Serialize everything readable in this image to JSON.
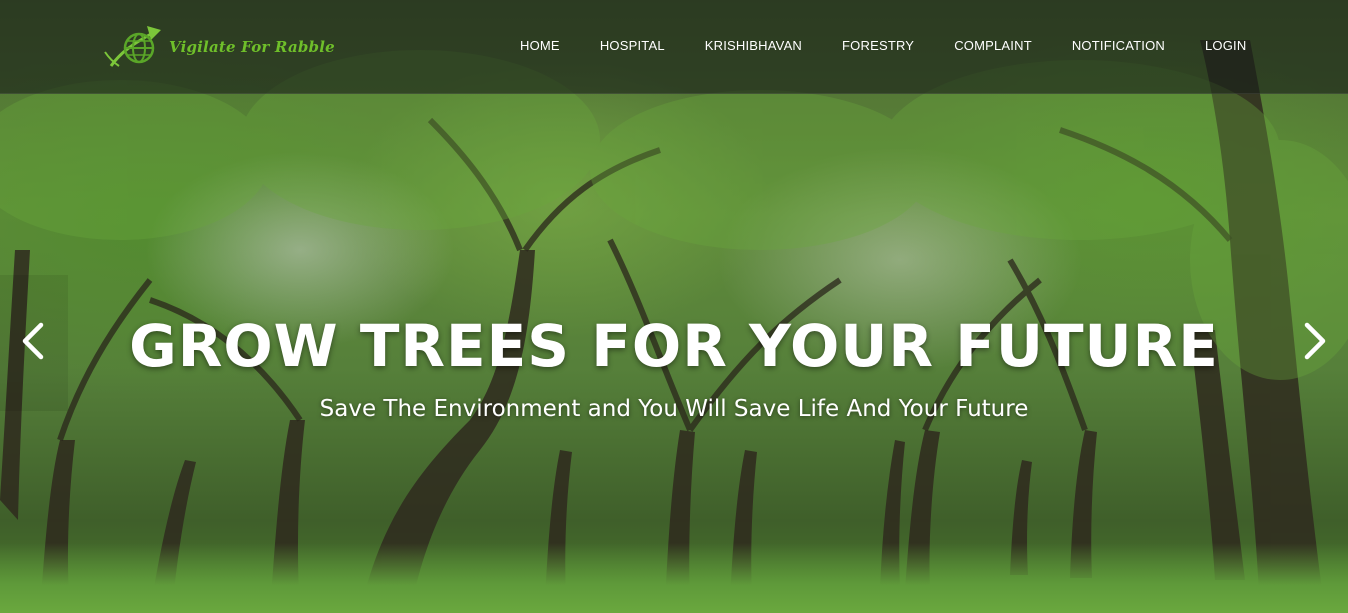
{
  "brand": {
    "name": "Vigilate For Rabble",
    "colors": {
      "brand_green": "#6fbf2a",
      "globe_green": "#5aa628"
    },
    "icon": "globe-arrow-logo-icon"
  },
  "nav": {
    "items": [
      {
        "label": "HOME"
      },
      {
        "label": "HOSPITAL"
      },
      {
        "label": "KRISHIBHAVAN"
      },
      {
        "label": "FORESTRY"
      },
      {
        "label": "COMPLAINT"
      },
      {
        "label": "NOTIFICATION"
      },
      {
        "label": "LOGIN"
      }
    ]
  },
  "hero": {
    "title": "GROW TREES FOR YOUR FUTURE",
    "subtitle": "Save The Environment and You Will Save Life And Your Future",
    "prev_icon": "chevron-left-icon",
    "next_icon": "chevron-right-icon"
  }
}
